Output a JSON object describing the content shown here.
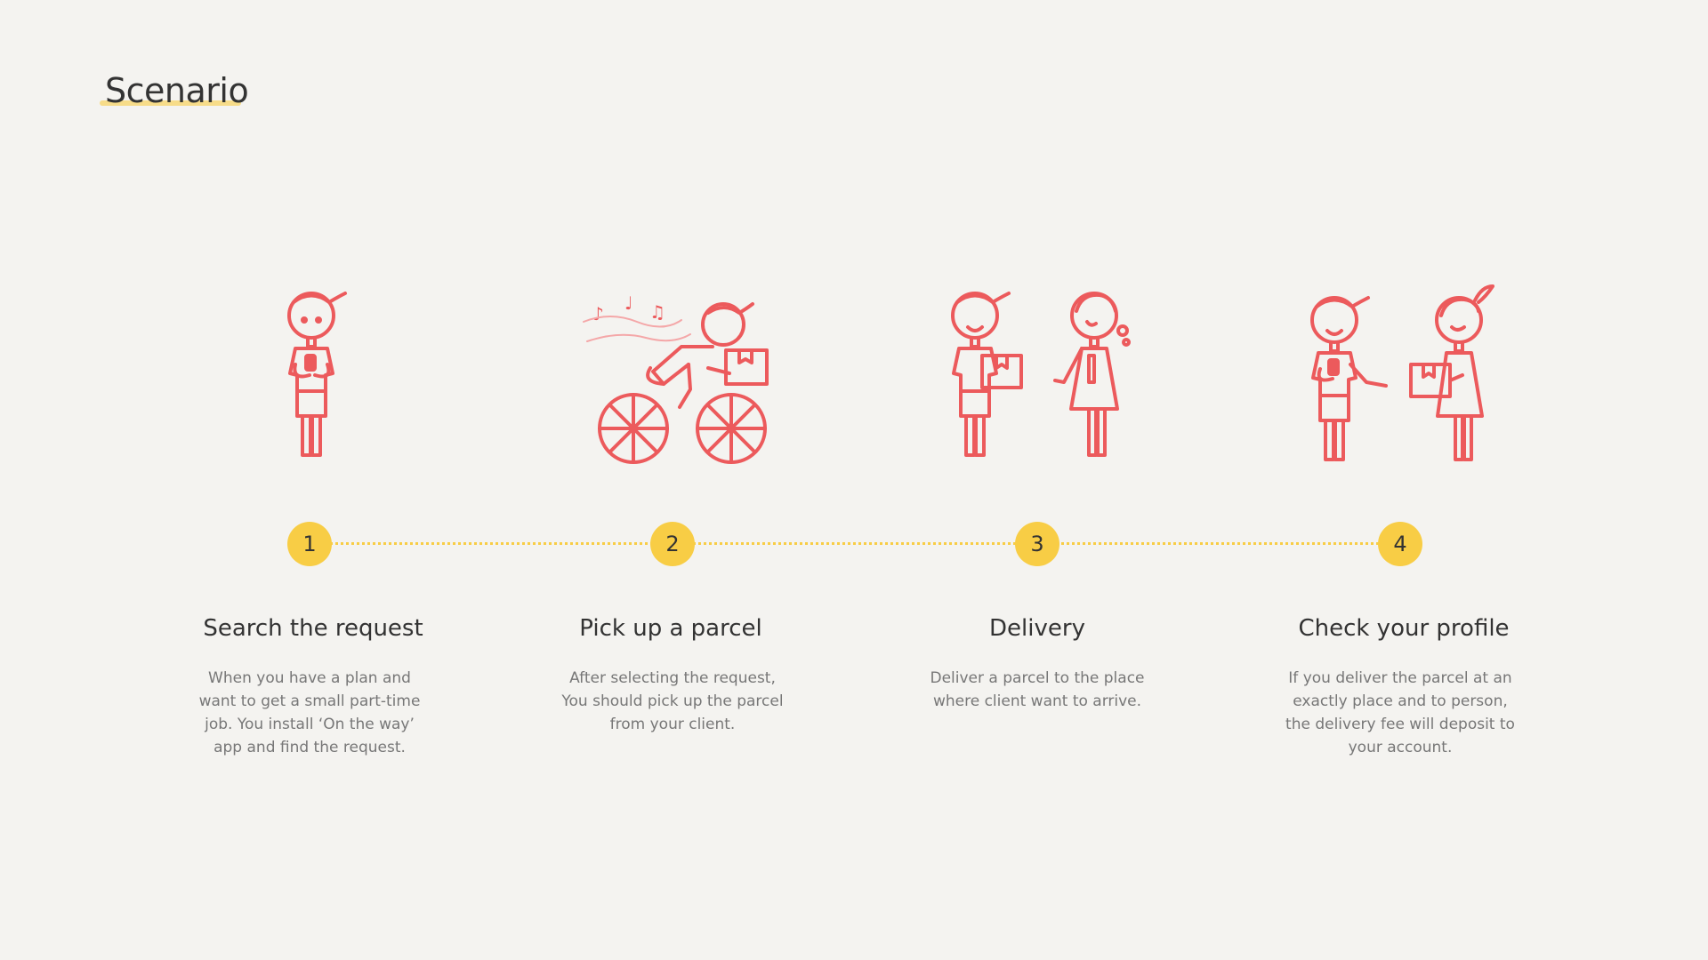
{
  "title": "Scenario",
  "colors": {
    "background": "#f4f3f0",
    "accent_yellow": "#f8cd45",
    "illustration_red": "#ec5a5c",
    "text_dark": "#333333",
    "text_muted": "#777777"
  },
  "steps": [
    {
      "number": "1",
      "title": "Search the request",
      "description": "When you have a plan and\nwant to get a small part-time\njob. You install ‘On the way’\napp and find the request.",
      "icon": "person-with-phone-icon"
    },
    {
      "number": "2",
      "title": "Pick up a parcel",
      "description": "After selecting the request,\nYou should pick up the parcel\nfrom your client.",
      "icon": "cyclist-with-parcel-icon"
    },
    {
      "number": "3",
      "title": "Delivery",
      "description": "Deliver a  parcel to the place\nwhere client want to arrive.",
      "icon": "courier-and-client-icon"
    },
    {
      "number": "4",
      "title": "Check your profile",
      "description": "If you deliver the parcel at an\nexactly place and to person,\nthe delivery fee will deposit to\nyour account.",
      "icon": "handover-parcel-icon"
    }
  ]
}
